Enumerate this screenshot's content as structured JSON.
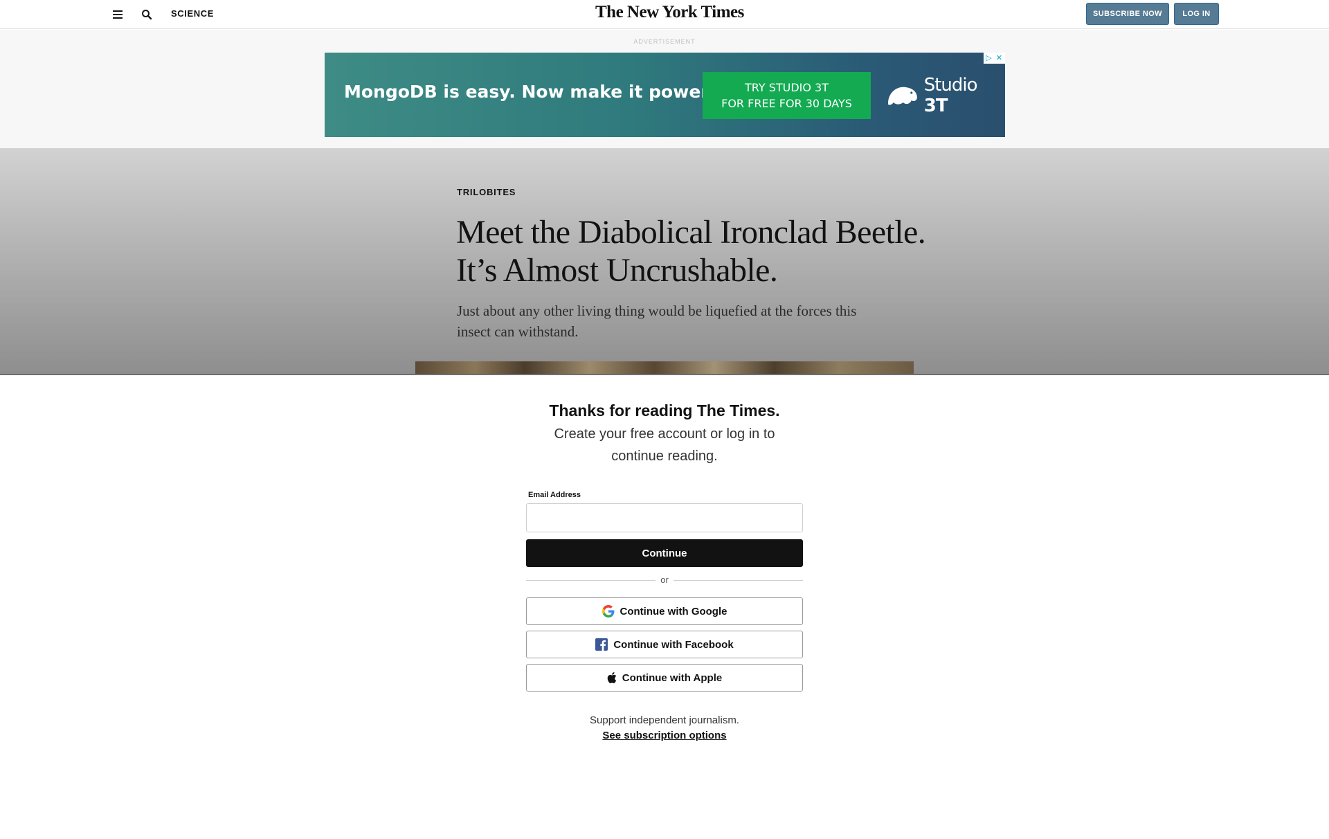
{
  "header": {
    "section": "SCIENCE",
    "masthead": "The New York Times",
    "subscribe_label": "SUBSCRIBE NOW",
    "login_label": "LOG IN"
  },
  "ad": {
    "label": "ADVERTISEMENT",
    "headline": "MongoDB is easy. Now make it powerful.",
    "cta_line1": "TRY STUDIO 3T",
    "cta_line2": "FOR FREE FOR 30 DAYS",
    "brand_name": "Studio",
    "brand_suffix": "3T",
    "choices_icon": "▷",
    "close_icon": "✕"
  },
  "article": {
    "kicker": "TRILOBITES",
    "headline": "Meet the Diabolical Ironclad Beetle. It’s Almost Uncrushable.",
    "summary": "Just about any other living thing would be liquefied at the forces this insect can withstand."
  },
  "paywall": {
    "title": "Thanks for reading The Times.",
    "subtitle": "Create your free account or log in to continue reading.",
    "email_label": "Email Address",
    "email_value": "",
    "continue_label": "Continue",
    "or_label": "or",
    "google_label": "Continue with Google",
    "facebook_label": "Continue with Facebook",
    "apple_label": "Continue with Apple",
    "support_text": "Support independent journalism.",
    "subscription_link": "See subscription options"
  },
  "icons": {
    "menu": "menu-icon",
    "search": "search-icon",
    "google": "google-icon",
    "facebook": "facebook-icon",
    "apple": "apple-icon"
  },
  "colors": {
    "accent_blue": "#567b95",
    "continue_black": "#121212",
    "ad_cta_green": "#13aa52",
    "facebook_blue": "#3b5998"
  }
}
